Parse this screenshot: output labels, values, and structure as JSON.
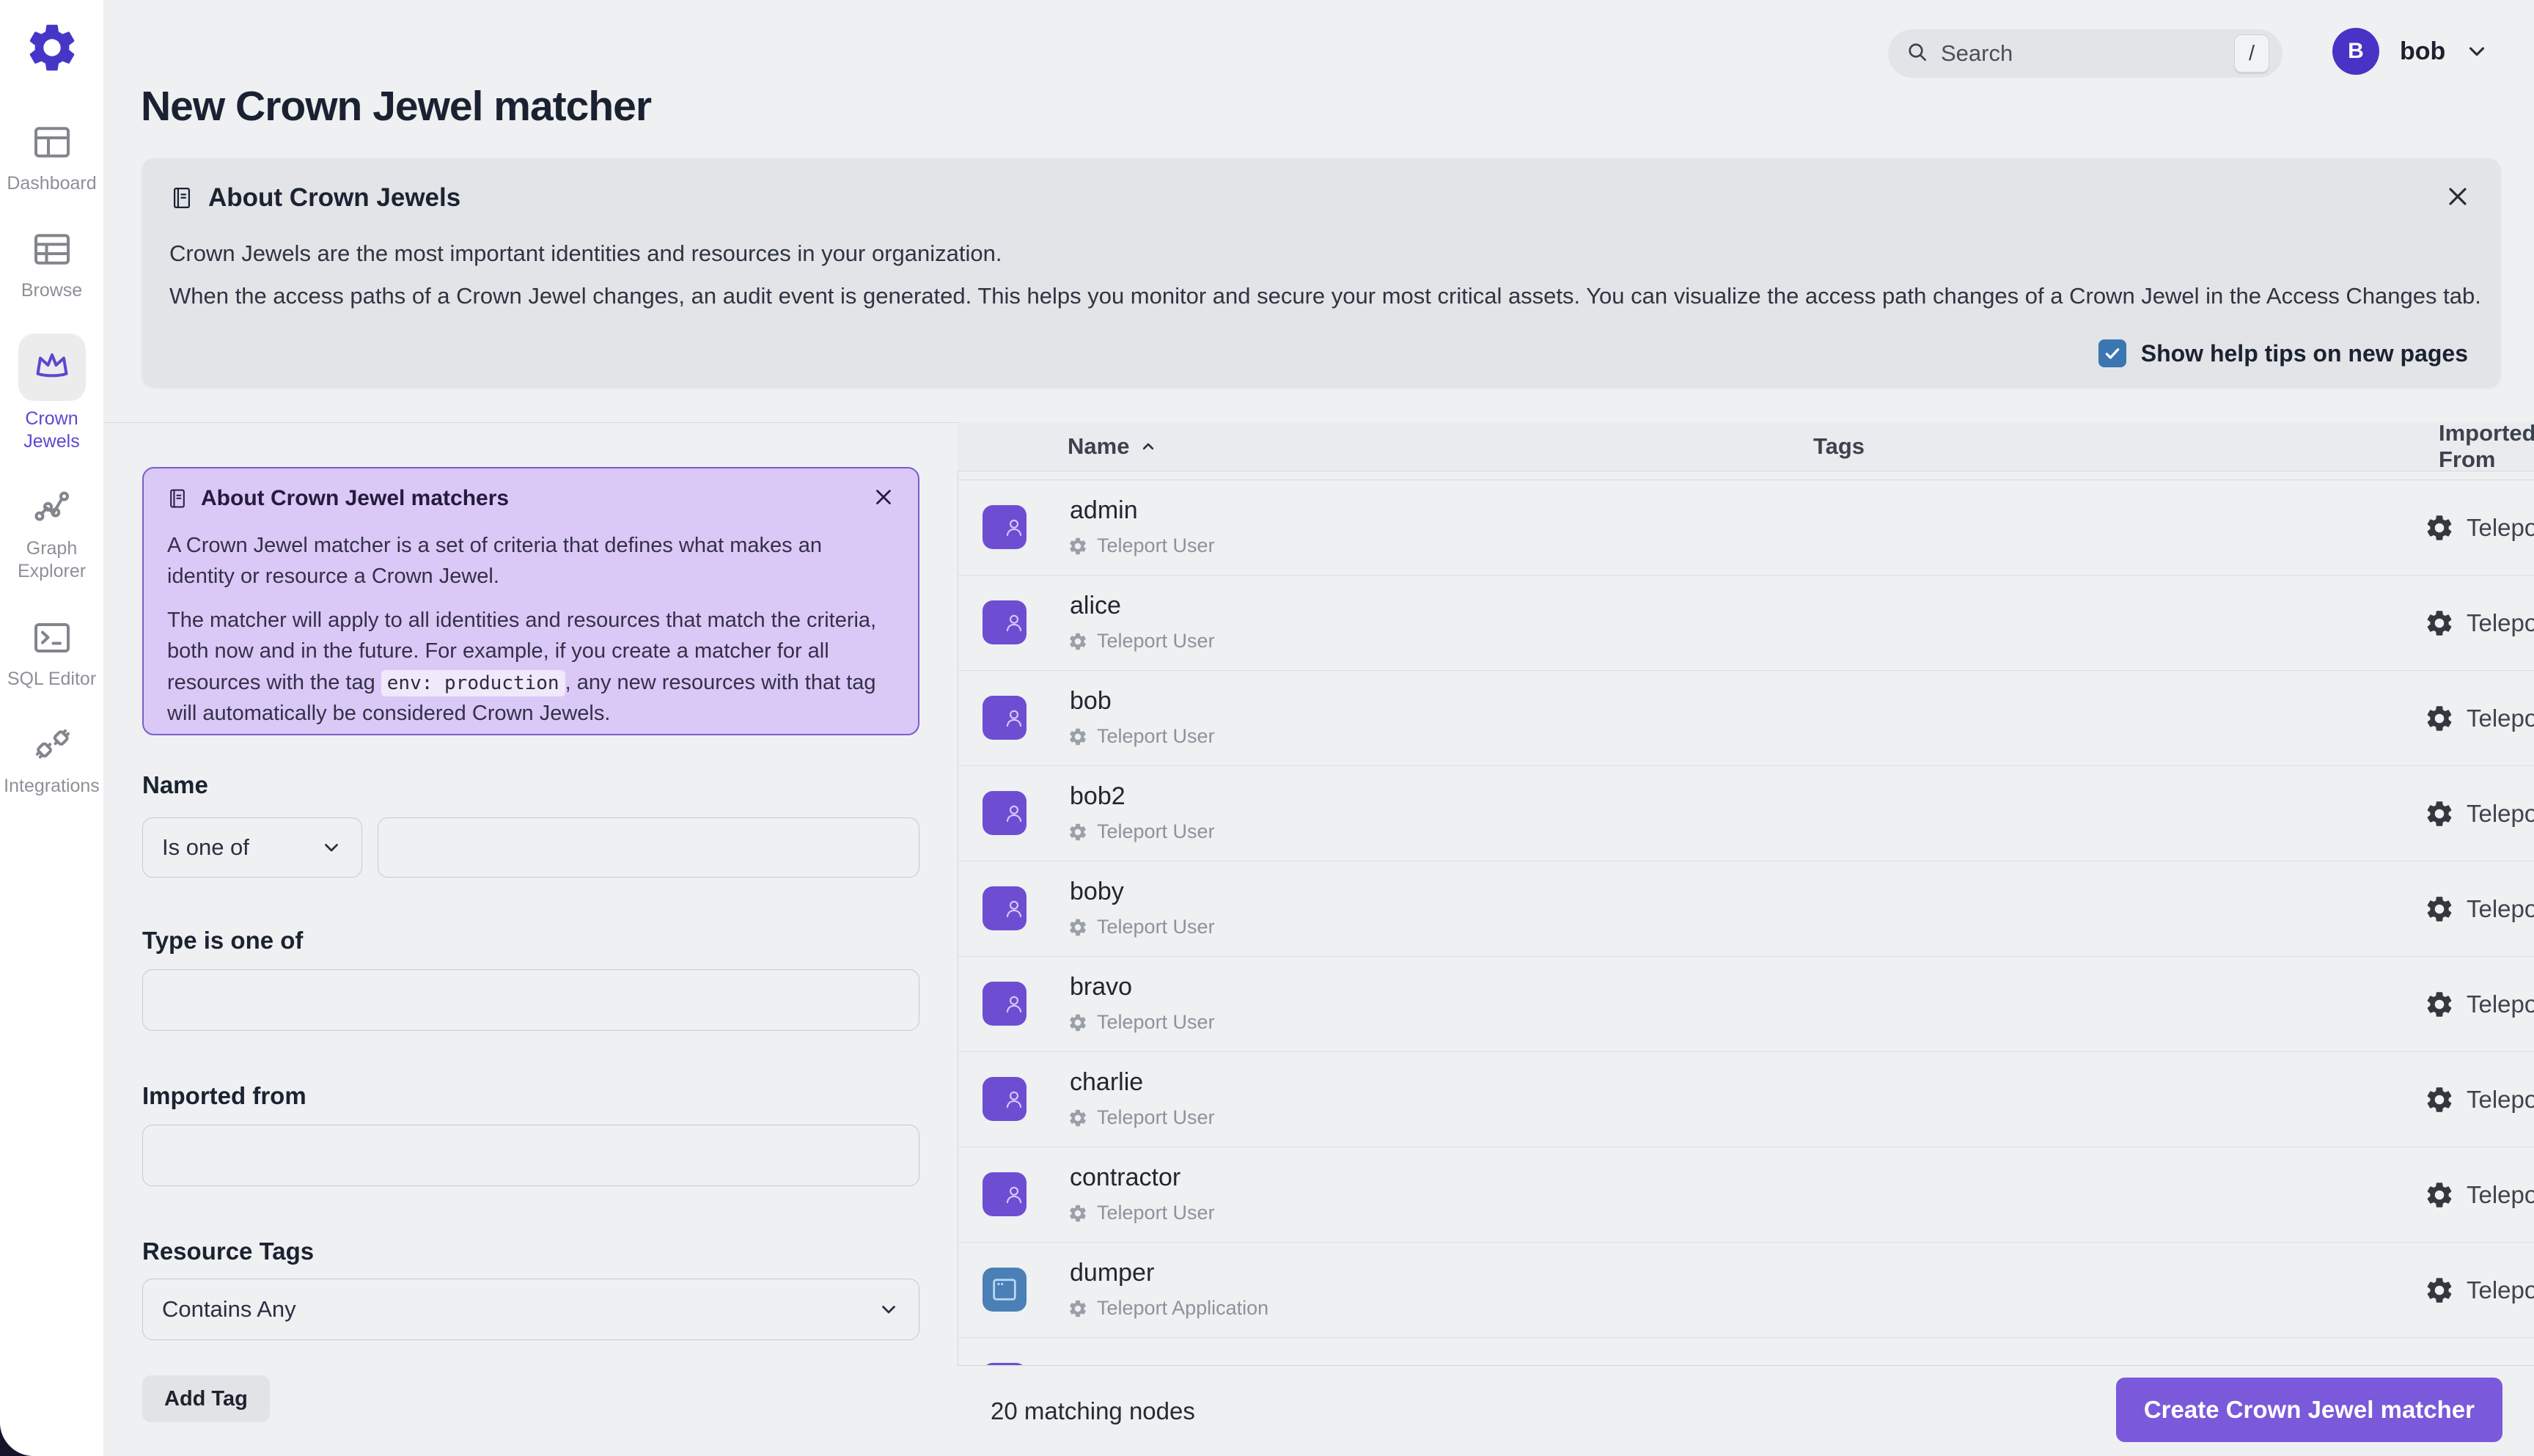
{
  "brand": {
    "logo_icon": "gear-icon",
    "logo_color": "#4636c8"
  },
  "sidebar": {
    "items": [
      {
        "label": "Dashboard",
        "icon": "dashboard-icon",
        "active": false
      },
      {
        "label": "Browse",
        "icon": "browse-icon",
        "active": false
      },
      {
        "label": "Crown Jewels",
        "icon": "crown-icon",
        "active": true
      },
      {
        "label": "Graph Explorer",
        "icon": "graph-icon",
        "active": false
      },
      {
        "label": "SQL Editor",
        "icon": "terminal-icon",
        "active": false
      },
      {
        "label": "Integrations",
        "icon": "plug-icon",
        "active": false
      }
    ]
  },
  "header": {
    "search_placeholder": "Search",
    "search_shortcut": "/",
    "user_initial": "B",
    "user_name": "bob"
  },
  "page": {
    "title": "New Crown Jewel matcher"
  },
  "about_banner": {
    "title": "About Crown Jewels",
    "p1": "Crown Jewels are the most important identities and resources in your organization.",
    "p2": "When the access paths of a Crown Jewel changes, an audit event is generated. This helps you monitor and secure your most critical assets. You can visualize the access path changes of a Crown Jewel in the Access Changes tab.",
    "checkbox_label": "Show help tips on new pages",
    "checkbox_checked": true,
    "checkbox_color": "#3b76b2"
  },
  "matcher_info": {
    "title": "About Crown Jewel matchers",
    "p1": "A Crown Jewel matcher is a set of criteria that defines what makes an identity or resource a Crown Jewel.",
    "p2_start": "The matcher will apply to all identities and resources that match the criteria, both now and in the future. For example, if you create a matcher for all resources with the tag ",
    "p2_code": "env: production",
    "p2_end": ", any new resources with that tag will automatically be considered Crown Jewels.",
    "bg_color": "#dac9f6",
    "border_color": "#7a5ec8"
  },
  "form": {
    "name_label": "Name",
    "name_operator": "Is one of",
    "name_value": "",
    "type_label": "Type is one of",
    "type_value": "",
    "imported_label": "Imported from",
    "imported_value": "",
    "tags_label": "Resource Tags",
    "tags_operator": "Contains Any",
    "add_tag_label": "Add Tag"
  },
  "table": {
    "columns": [
      {
        "label": "Name",
        "sorted_asc": true
      },
      {
        "label": "Tags",
        "sorted_asc": false
      },
      {
        "label": "Imported From",
        "sorted_asc": false
      }
    ],
    "rows": [
      {
        "name": "admin",
        "type": "Teleport User",
        "icon": "user-avatar-icon",
        "imported": "Teleport"
      },
      {
        "name": "alice",
        "type": "Teleport User",
        "icon": "user-avatar-icon",
        "imported": "Teleport"
      },
      {
        "name": "bob",
        "type": "Teleport User",
        "icon": "user-avatar-icon",
        "imported": "Teleport"
      },
      {
        "name": "bob2",
        "type": "Teleport User",
        "icon": "user-avatar-icon",
        "imported": "Teleport"
      },
      {
        "name": "boby",
        "type": "Teleport User",
        "icon": "user-avatar-icon",
        "imported": "Teleport"
      },
      {
        "name": "bravo",
        "type": "Teleport User",
        "icon": "user-avatar-icon",
        "imported": "Teleport"
      },
      {
        "name": "charlie",
        "type": "Teleport User",
        "icon": "user-avatar-icon",
        "imported": "Teleport"
      },
      {
        "name": "contractor",
        "type": "Teleport User",
        "icon": "user-avatar-icon",
        "imported": "Teleport"
      },
      {
        "name": "dumper",
        "type": "Teleport Application",
        "icon": "app-window-icon",
        "imported": "Teleport"
      }
    ]
  },
  "footer": {
    "count_text": "20 matching nodes",
    "create_label": "Create Crown Jewel matcher",
    "create_color": "#7a59da"
  },
  "colors": {
    "page_bg": "#eef0f2",
    "sidebar_bg": "#ffffff",
    "banner_bg": "#e2e4e8",
    "brand_purple": "#4636c8",
    "row_user_purple": "#6d4ed2",
    "row_app_blue": "#4a80b6"
  }
}
